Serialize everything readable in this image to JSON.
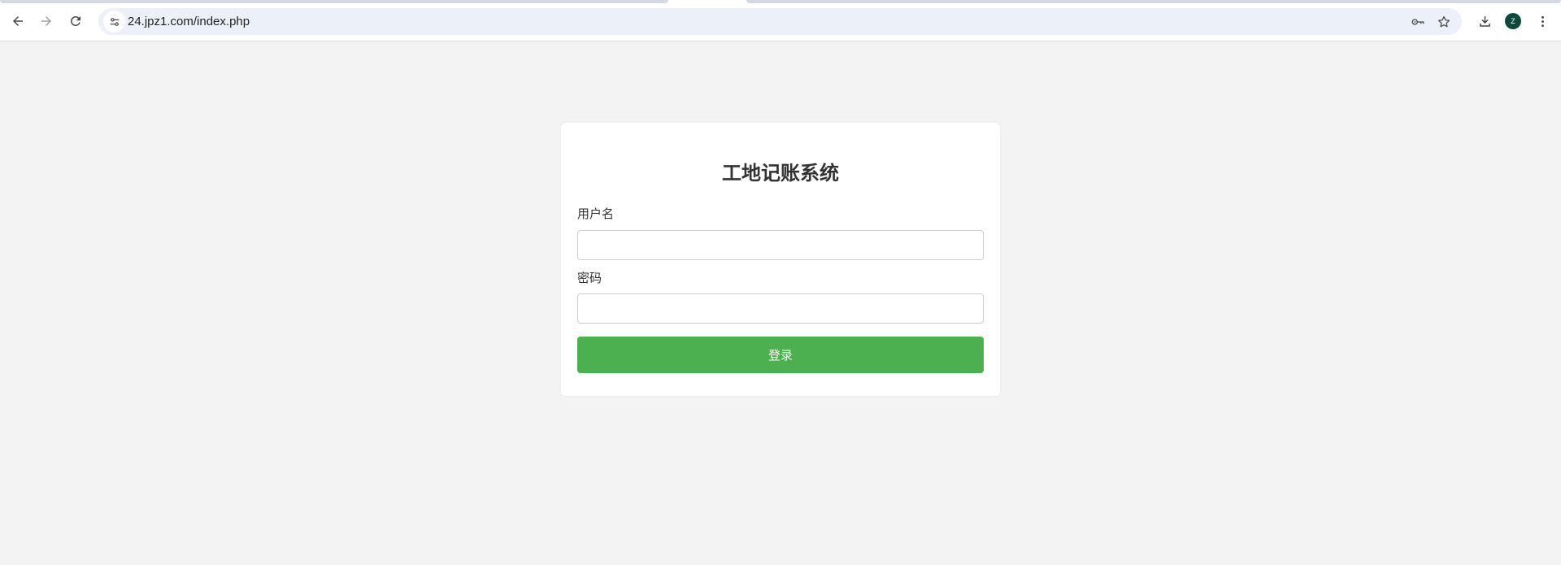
{
  "browser": {
    "url": "24.jpz1.com/index.php",
    "profile_initial": "Z",
    "icons": {
      "back": "arrow-left-icon",
      "forward": "arrow-right-icon",
      "reload": "reload-icon",
      "site_info": "tune-icon",
      "password": "key-icon",
      "bookmark": "star-icon",
      "download": "download-icon",
      "menu": "more-vertical-icon"
    },
    "colors": {
      "omnibox": "#ecf0f8",
      "avatar": "#0b4a3c"
    }
  },
  "login": {
    "title": "工地记账系统",
    "username_label": "用户名",
    "username_value": "",
    "password_label": "密码",
    "password_value": "",
    "submit_label": "登录"
  },
  "colors": {
    "page_background": "#f3f3f3",
    "card_background": "#ffffff",
    "accent": "#4caf50"
  }
}
